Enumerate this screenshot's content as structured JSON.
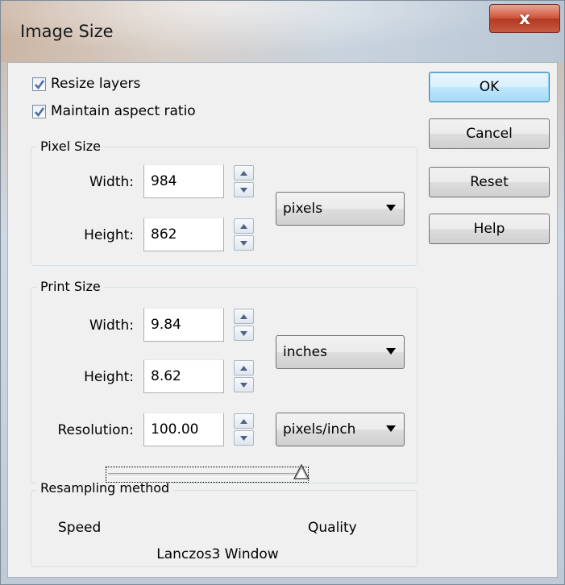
{
  "window": {
    "title": "Image Size",
    "close_label": "x"
  },
  "options": {
    "resize_layers": {
      "label": "Resize layers",
      "checked": true
    },
    "maintain_aspect": {
      "label": "Maintain aspect ratio",
      "checked": true
    }
  },
  "pixel_size": {
    "group_label": "Pixel Size",
    "width_label": "Width:",
    "width_value": "984",
    "height_label": "Height:",
    "height_value": "862",
    "unit": "pixels"
  },
  "print_size": {
    "group_label": "Print Size",
    "width_label": "Width:",
    "width_value": "9.84",
    "height_label": "Height:",
    "height_value": "8.62",
    "unit": "inches",
    "resolution_label": "Resolution:",
    "resolution_value": "100.00",
    "resolution_unit": "pixels/inch"
  },
  "resampling": {
    "group_label": "Resampling method",
    "left_label": "Speed",
    "right_label": "Quality",
    "method": "Lanczos3 Window",
    "level": 1.0
  },
  "buttons": {
    "ok": "OK",
    "cancel": "Cancel",
    "reset": "Reset",
    "help": "Help"
  },
  "icons": {
    "check": "checkmark-icon",
    "spin_up": "spin-up-icon",
    "spin_down": "spin-down-icon",
    "dropdown": "chevron-down-icon",
    "close": "close-icon"
  },
  "colors": {
    "dialog_bg": "#f0f0f0",
    "default_button_border": "#3c7fb1",
    "close_button": "#c75a40",
    "check_color": "#4a6fa5"
  }
}
